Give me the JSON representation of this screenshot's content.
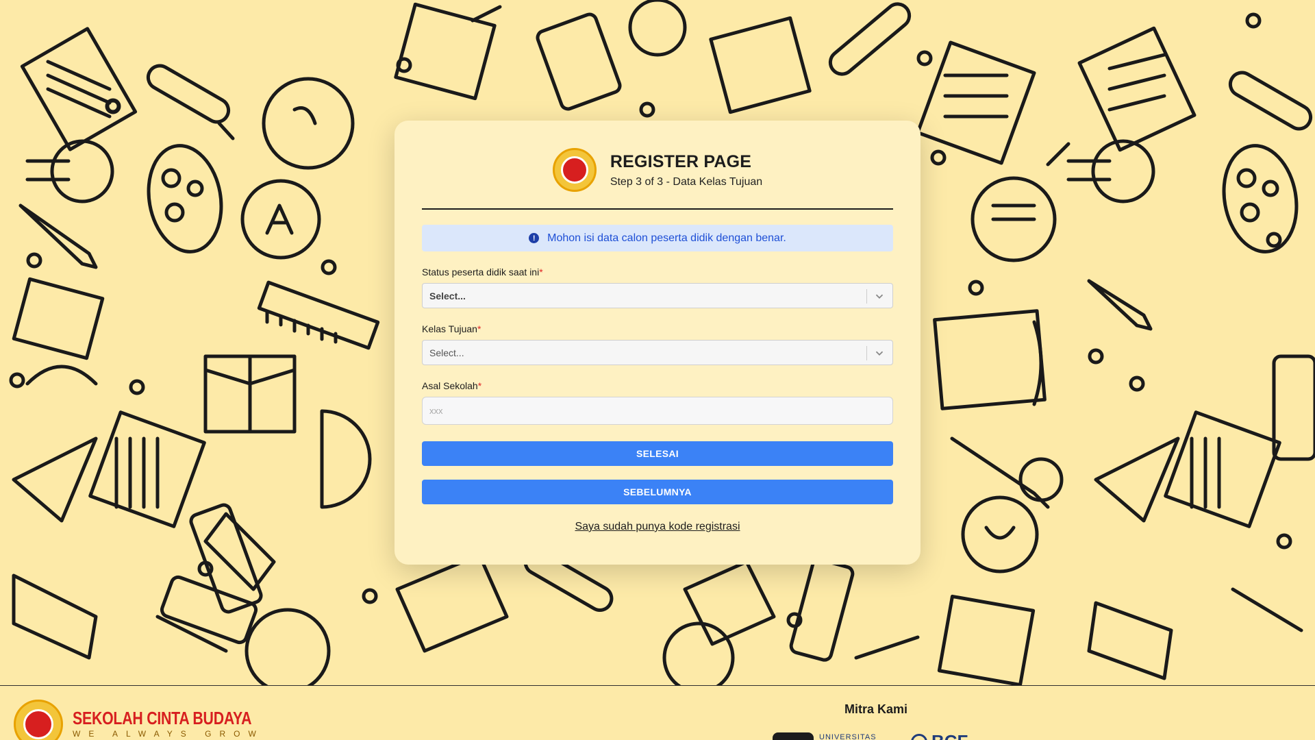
{
  "card": {
    "title": "REGISTER PAGE",
    "subtitle": "Step 3 of 3 - Data Kelas Tujuan",
    "alert": "Mohon isi data calon peserta didik dengan benar.",
    "fields": [
      {
        "label": "Status peserta didik saat ini",
        "value": "Select..."
      },
      {
        "label": "Kelas Tujuan",
        "value": "Select..."
      },
      {
        "label": "Asal Sekolah",
        "placeholder": "xxx"
      }
    ],
    "required_mark": "*",
    "submit_label": "SELESAI",
    "back_label": "SEBELUMNYA",
    "link_label": "Saya sudah punya kode registrasi"
  },
  "footer": {
    "brand_name": "SEKOLAH CINTA BUDAYA",
    "brand_tagline": "WE ALWAYS GROW",
    "partners_title": "Mitra Kami",
    "partner1_text": "UNIVERSITAS",
    "partner2_text": "BCF"
  },
  "colors": {
    "background": "#fdeaa8",
    "card": "#fef1c2",
    "primary": "#3b82f6",
    "alert_bg": "#dbe7fb",
    "alert_text": "#1e4fd6",
    "brand_red": "#d71f1f"
  },
  "icons": {
    "alert": "info-circle-icon",
    "select": "chevron-down-icon"
  }
}
